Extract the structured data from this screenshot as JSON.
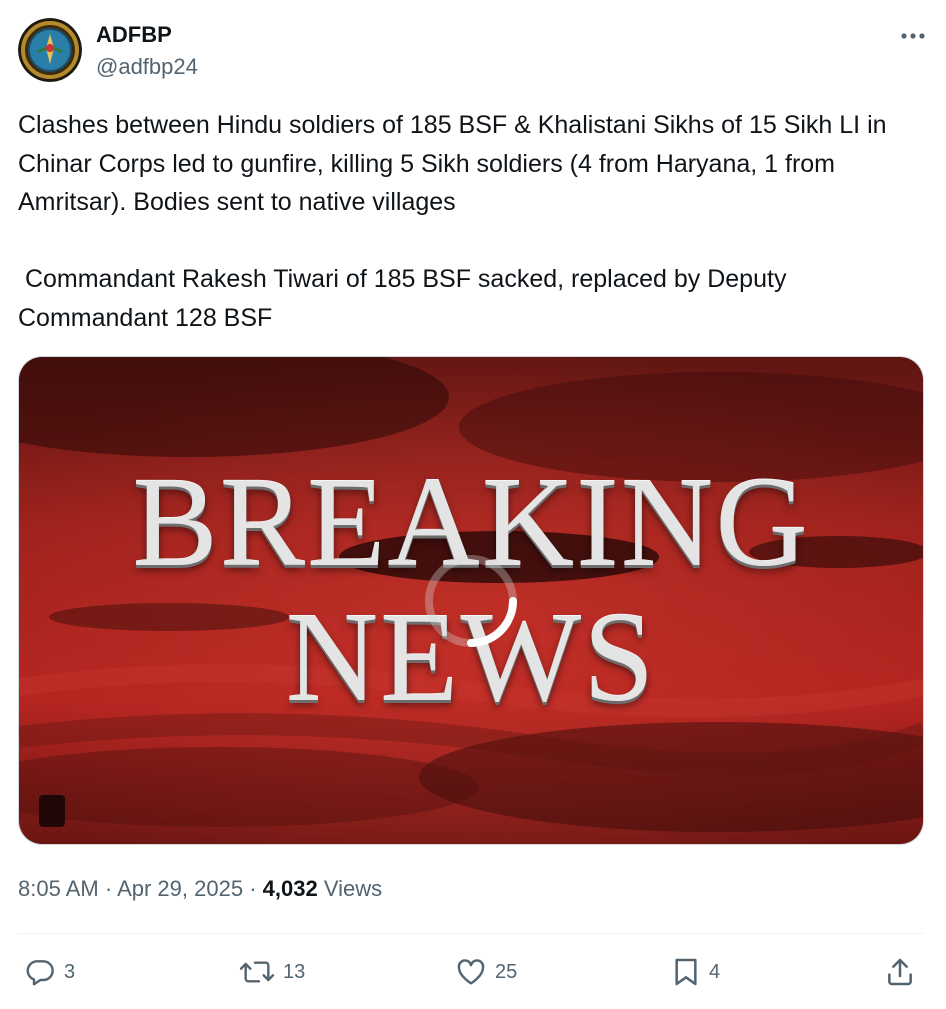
{
  "author": {
    "name": "ADFBP",
    "handle": "@adfbp24"
  },
  "tweet": {
    "text": "Clashes between Hindu soldiers of 185 BSF & Khalistani Sikhs of 15 Sikh LI in Chinar Corps led to gunfire, killing 5 Sikh soldiers (4 from Haryana, 1 from Amritsar). Bodies sent to native villages\n\n Commandant Rakesh Tiwari of 185 BSF sacked, replaced by Deputy Commandant 128 BSF"
  },
  "media": {
    "title_line1": "BREAKING",
    "title_line2": "NEWS",
    "state": "loading"
  },
  "meta": {
    "time": "8:05 AM",
    "separator": "·",
    "date": "Apr 29, 2025",
    "views_count": "4,032",
    "views_label": "Views"
  },
  "actions": {
    "replies": "3",
    "reposts": "13",
    "likes": "25",
    "bookmarks": "4"
  },
  "icons": {
    "avatar": "emblem-logo",
    "more": "more-dots-icon",
    "reply": "reply-icon",
    "repost": "repost-icon",
    "like": "heart-icon",
    "bookmark": "bookmark-icon",
    "share": "share-icon",
    "loading": "loading-spinner-icon"
  },
  "colors": {
    "text": "#0f1419",
    "secondary": "#536471",
    "divider": "#eff3f4",
    "media_red": "#b3231f"
  }
}
